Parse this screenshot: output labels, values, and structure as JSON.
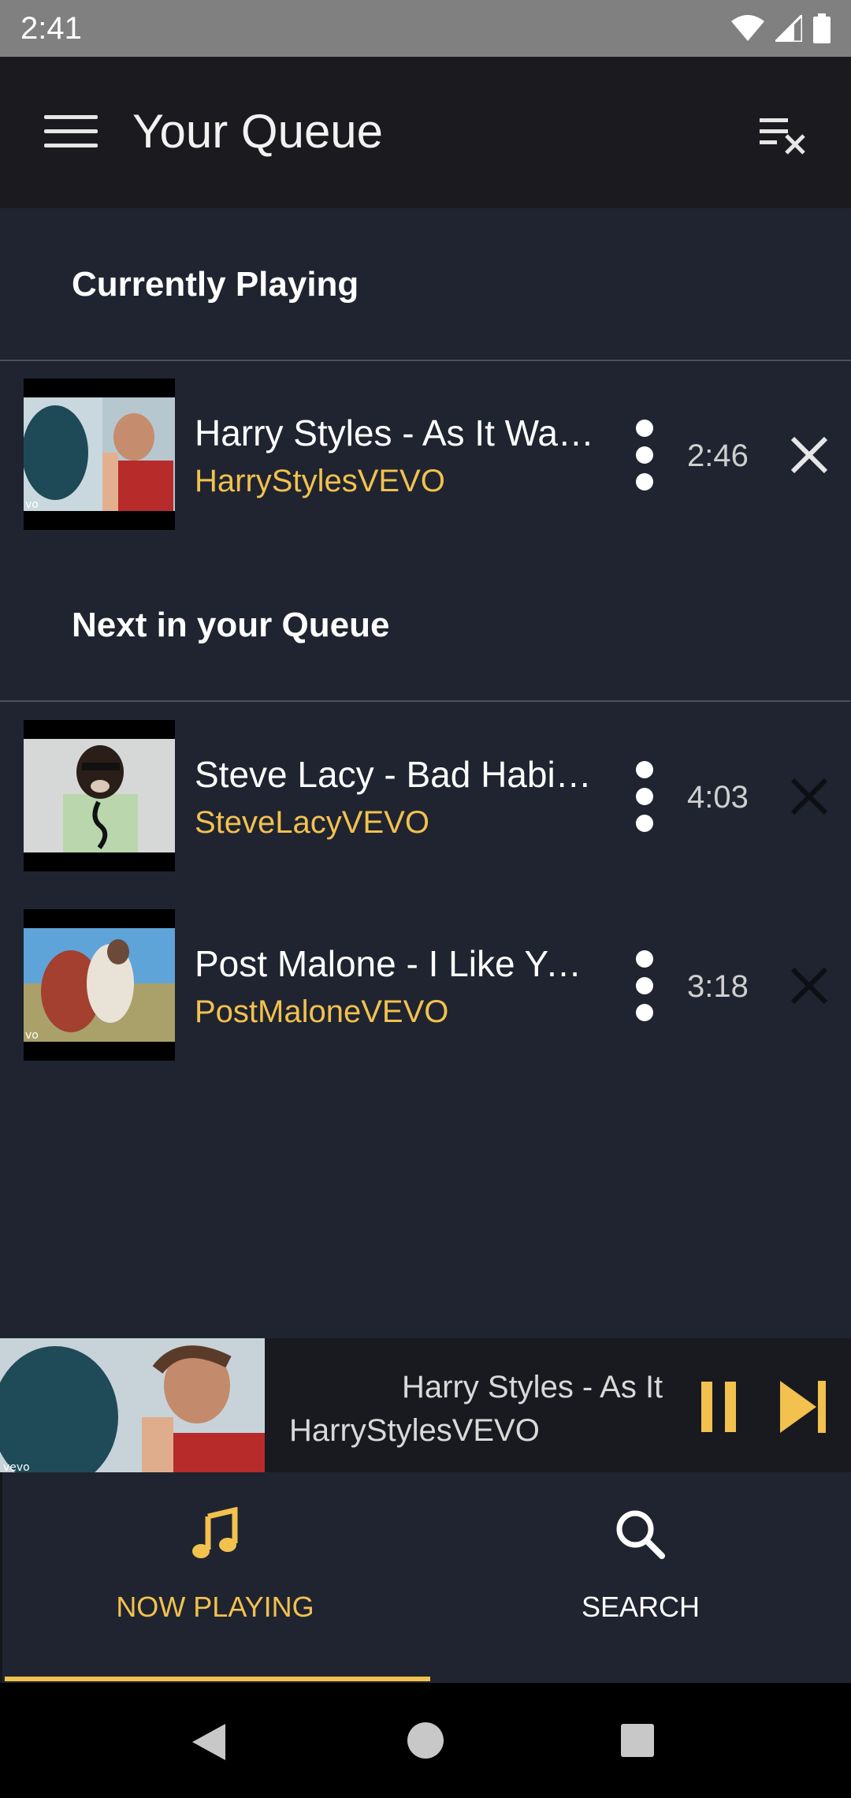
{
  "status_bar": {
    "time": "2:41"
  },
  "app_bar": {
    "title": "Your Queue",
    "menu_icon": "menu-icon",
    "clear_icon": "clear-queue-icon"
  },
  "sections": {
    "current": {
      "title": "Currently Playing"
    },
    "next": {
      "title": "Next in your Queue"
    }
  },
  "current_item": {
    "title": "Harry Styles - As It Was (Official Video)",
    "channel": "HarryStylesVEVO",
    "duration": "2:46"
  },
  "queue": [
    {
      "title": "Steve Lacy - Bad Habit (Official Video)",
      "channel": "SteveLacyVEVO",
      "duration": "4:03"
    },
    {
      "title": "Post Malone - I Like You (A Happier Song)",
      "channel": "PostMaloneVEVO",
      "duration": "3:18"
    }
  ],
  "mini_player": {
    "title": "Harry Styles - As It",
    "channel": "HarryStylesVEVO"
  },
  "bottom_nav": {
    "now_playing": "NOW PLAYING",
    "search": "SEARCH"
  },
  "colors": {
    "accent": "#f2c14e",
    "background": "#1f2430",
    "app_bar": "#1b1b1f"
  }
}
